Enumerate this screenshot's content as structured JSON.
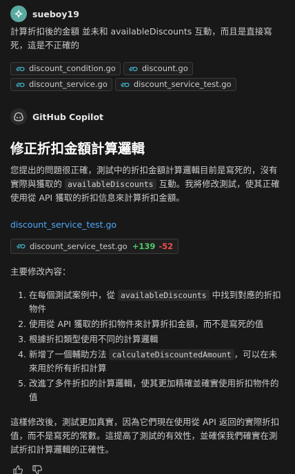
{
  "user": {
    "name": "sueboy19",
    "message": "計算折扣後的金額 並未和 availableDiscounts 互動，而且是直接寫死，這是不正確的"
  },
  "attachments": [
    {
      "label": "discount_condition.go"
    },
    {
      "label": "discount.go"
    },
    {
      "label": "discount_service.go"
    },
    {
      "label": "discount_service_test.go"
    }
  ],
  "assistant": {
    "name": "GitHub Copilot",
    "heading": "修正折扣金額計算邏輯",
    "intro_before": "您提出的問題很正確，測試中的折扣金額計算邏輯目前是寫死的，沒有實際與獲取的 ",
    "intro_code": "availableDiscounts",
    "intro_after": " 互動。我將修改測試，使其正確使用從 API 獲取的折扣信息來計算折扣金額。",
    "file_link": "discount_service_test.go",
    "file_change": {
      "file": "discount_service_test.go",
      "added": "+139",
      "removed": "-52"
    },
    "changes_title": "主要修改內容：",
    "changes": [
      {
        "before": "在每個測試案例中，從 ",
        "code": "availableDiscounts",
        "after": " 中找到對應的折扣物件"
      },
      {
        "before": "使用從 API 獲取的折扣物件來計算折扣金額，而不是寫死的值",
        "code": "",
        "after": ""
      },
      {
        "before": "根據折扣類型使用不同的計算邏輯",
        "code": "",
        "after": ""
      },
      {
        "before": "新增了一個輔助方法 ",
        "code": "calculateDiscountedAmount",
        "after": "，可以在未來用於所有折扣計算"
      },
      {
        "before": "改進了多件折扣的計算邏輯，使其更加精確並確實使用折扣物件的值",
        "code": "",
        "after": ""
      }
    ],
    "summary": "這樣修改後，測試更加真實，因為它們現在使用從 API 返回的實際折扣值，而不是寫死的常數。這提高了測試的有效性，並確保我們確實在測試折扣計算邏輯的正確性。"
  },
  "feedback": {
    "like_icon": "thumbs-up-icon",
    "dislike_icon": "thumbs-down-icon"
  },
  "colors": {
    "background": "#181818",
    "link": "#4daafc",
    "added": "#4ec969",
    "removed": "#f14c4c"
  }
}
